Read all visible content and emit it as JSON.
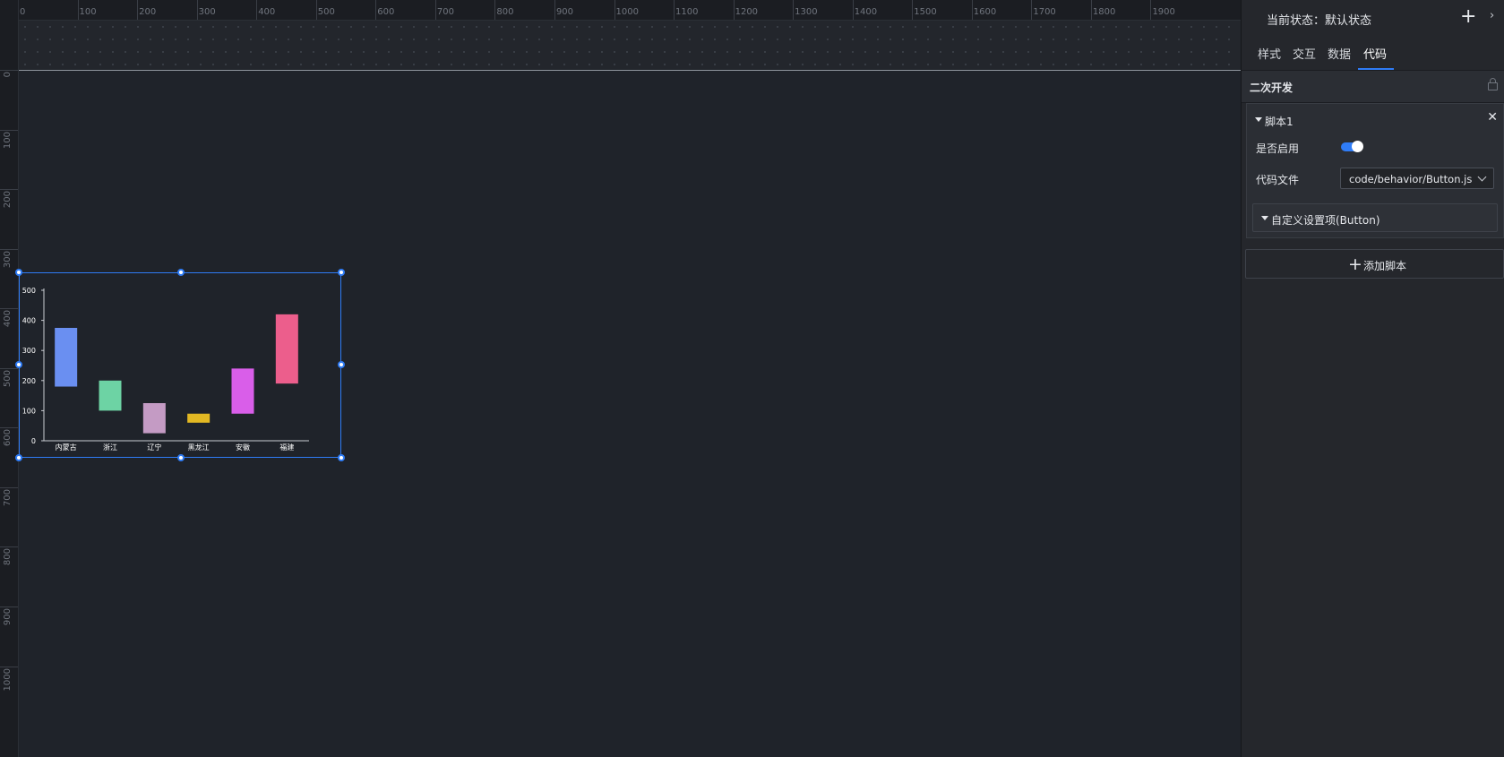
{
  "ruler": {
    "horizontal": [
      "0",
      "100",
      "200",
      "300",
      "400",
      "500",
      "600",
      "700",
      "800",
      "900",
      "1000",
      "1100",
      "1200",
      "1300",
      "1400",
      "1500",
      "1600",
      "1700",
      "1800",
      "1900"
    ],
    "vertical": [
      "0",
      "100",
      "200",
      "300",
      "400",
      "500",
      "600",
      "700",
      "800",
      "900",
      "1000"
    ]
  },
  "chart_data": {
    "type": "bar",
    "categories": [
      "内蒙古",
      "浙江",
      "辽宁",
      "黑龙江",
      "安徽",
      "福建"
    ],
    "ranges": [
      [
        180,
        375
      ],
      [
        100,
        200
      ],
      [
        25,
        125
      ],
      [
        60,
        90
      ],
      [
        90,
        240
      ],
      [
        190,
        420
      ]
    ],
    "colors": [
      "#6a8ff1",
      "#6dd3a4",
      "#c49bc4",
      "#e2b823",
      "#d95ee9",
      "#ec5e8c"
    ],
    "yticks": [
      "0",
      "100",
      "200",
      "300",
      "400",
      "500"
    ],
    "ylim": [
      0,
      500
    ],
    "grid": false
  },
  "panel": {
    "state_label": "当前状态：默认状态",
    "add_icon": "plus-icon",
    "collapse_icon": "chevron-right-icon",
    "tabs": [
      "样式",
      "交互",
      "数据",
      "代码"
    ],
    "active_tab": "代码",
    "section_title": "二次开发",
    "script": {
      "title": "脚本1",
      "close": "✕",
      "enable_label": "是否启用",
      "enabled": true,
      "code_file_label": "代码文件",
      "code_file_value": "code/behavior/Button.js",
      "custom_settings_label": "自定义设置项(Button)"
    },
    "add_script_label": "添加脚本",
    "accent_color": "#2f7cf6"
  }
}
